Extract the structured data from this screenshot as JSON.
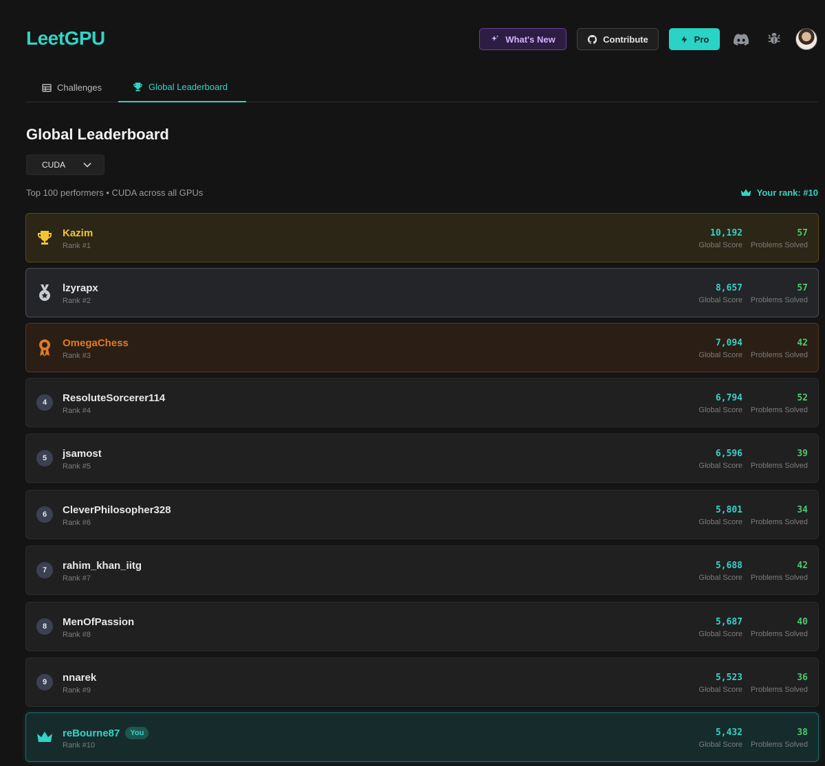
{
  "header": {
    "logo": "LeetGPU",
    "whats_new_label": "What's New",
    "contribute_label": "Contribute",
    "pro_label": "Pro",
    "icons": [
      "sparkles-icon",
      "github-icon",
      "lightning-icon",
      "discord-icon",
      "bug-icon"
    ]
  },
  "tabs": [
    {
      "label": "Challenges",
      "icon": "table-icon",
      "active": false
    },
    {
      "label": "Global Leaderboard",
      "icon": "trophy-icon",
      "active": true
    }
  ],
  "page": {
    "title": "Global Leaderboard",
    "language_select": "CUDA",
    "subtitle": "Top 100 performers • CUDA across all GPUs",
    "your_rank": "Your rank: #10"
  },
  "labels": {
    "score": "Global Score",
    "solved": "Problems Solved",
    "you_badge": "You"
  },
  "leaderboard": [
    {
      "rank": 1,
      "name": "Kazim",
      "rank_label": "Rank #1",
      "score": "10,192",
      "solved": "57",
      "tier": "gold"
    },
    {
      "rank": 2,
      "name": "lzyrapx",
      "rank_label": "Rank #2",
      "score": "8,657",
      "solved": "57",
      "tier": "silver"
    },
    {
      "rank": 3,
      "name": "OmegaChess",
      "rank_label": "Rank #3",
      "score": "7,094",
      "solved": "42",
      "tier": "bronze"
    },
    {
      "rank": 4,
      "name": "ResoluteSorcerer114",
      "rank_label": "Rank #4",
      "score": "6,794",
      "solved": "52",
      "tier": "normal"
    },
    {
      "rank": 5,
      "name": "jsamost",
      "rank_label": "Rank #5",
      "score": "6,596",
      "solved": "39",
      "tier": "normal"
    },
    {
      "rank": 6,
      "name": "CleverPhilosopher328",
      "rank_label": "Rank #6",
      "score": "5,801",
      "solved": "34",
      "tier": "normal"
    },
    {
      "rank": 7,
      "name": "rahim_khan_iitg",
      "rank_label": "Rank #7",
      "score": "5,688",
      "solved": "42",
      "tier": "normal"
    },
    {
      "rank": 8,
      "name": "MenOfPassion",
      "rank_label": "Rank #8",
      "score": "5,687",
      "solved": "40",
      "tier": "normal"
    },
    {
      "rank": 9,
      "name": "nnarek",
      "rank_label": "Rank #9",
      "score": "5,523",
      "solved": "36",
      "tier": "normal"
    },
    {
      "rank": 10,
      "name": "reBourne87",
      "rank_label": "Rank #10",
      "score": "5,432",
      "solved": "38",
      "tier": "you"
    }
  ],
  "colors": {
    "accent": "#34d3c6",
    "gold": "#f4c430",
    "bronze": "#e07a22",
    "solved": "#4ec96a"
  }
}
